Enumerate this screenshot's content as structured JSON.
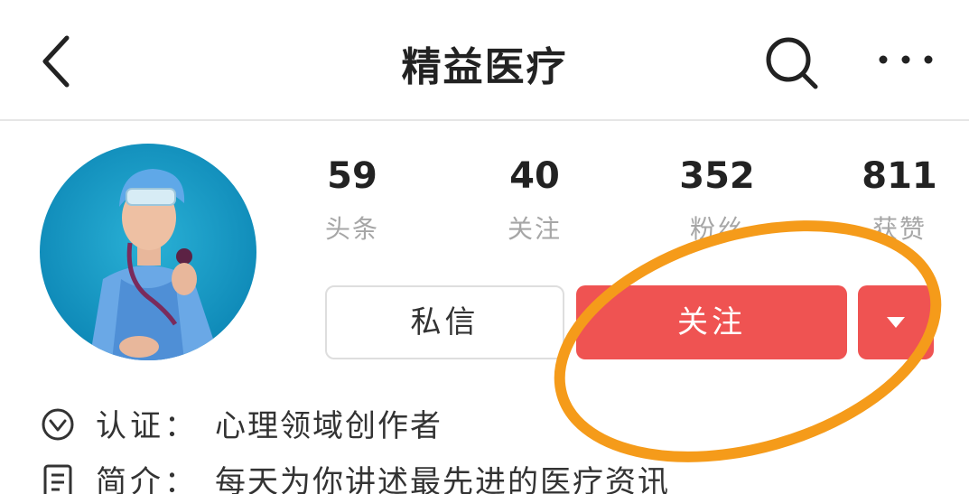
{
  "header": {
    "title": "精益医疗",
    "back_icon": "chevron-left-icon",
    "search_icon": "search-icon",
    "more_icon": "more-dots-icon"
  },
  "profile": {
    "avatar": "doctor-avatar-image",
    "stats": [
      {
        "value": "59",
        "label": "头条"
      },
      {
        "value": "40",
        "label": "关注"
      },
      {
        "value": "352",
        "label": "粉丝"
      },
      {
        "value": "811",
        "label": "获赞"
      }
    ],
    "buttons": {
      "message": "私信",
      "follow": "关注",
      "dropdown_icon": "caret-down-icon"
    },
    "info": [
      {
        "icon": "verified-check-icon",
        "key": "认证：",
        "value": "心理领域创作者"
      },
      {
        "icon": "document-icon",
        "key": "简介：",
        "value": "每天为你讲述最先进的医疗资讯"
      }
    ]
  },
  "annotation": {
    "color": "#f59b1a"
  },
  "colors": {
    "accent": "#ef5352",
    "muted_text": "#a6a6a6",
    "divider": "#e6e6e6"
  }
}
